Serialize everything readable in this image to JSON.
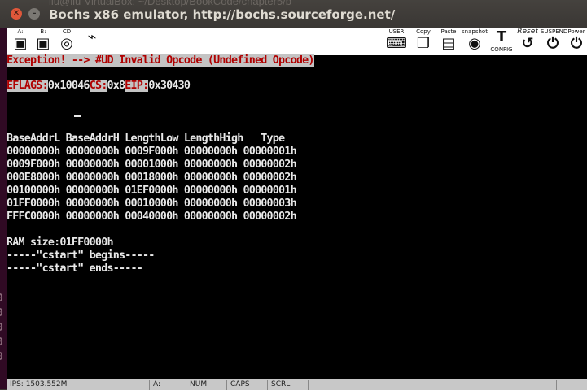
{
  "behind_window_title": "liu@liu-VirtualBox: ~/Desktop/BookCode/chapter5/b",
  "window": {
    "title": "Bochs x86 emulator, http://bochs.sourceforge.net/",
    "close_icon": "close-icon",
    "minimize_icon": "minimize-icon"
  },
  "toolbar": {
    "floppy_a_label": "A:",
    "floppy_b_label": "B:",
    "cd_label": "CD",
    "usb_label": "",
    "user_label": "USER",
    "copy_label": "Copy",
    "paste_label": "Paste",
    "snapshot_label": "snapshot",
    "config_label": "CONFIG",
    "reset_label": "Reset",
    "suspend_label": "SUSPEND",
    "power_label": "Power"
  },
  "screen": {
    "exception_line": "Exception! --> #UD Invalid Opcode (Undefined Opcode)",
    "eflags_label": "EFLAGS:",
    "eflags_value": "0x10046",
    "cs_label": "CS:",
    "cs_value": "0x8",
    "eip_label": "EIP:",
    "eip_value": "0x30430",
    "table_header": "BaseAddrL BaseAddrH LengthLow LengthHigh   Type",
    "table_rows": [
      "00000000h 00000000h 0009F000h 00000000h 00000001h",
      "0009F000h 00000000h 00001000h 00000000h 00000002h",
      "000E8000h 00000000h 00018000h 00000000h 00000002h",
      "00100000h 00000000h 01EF0000h 00000000h 00000001h",
      "01FF0000h 00000000h 00010000h 00000000h 00000003h",
      "FFFC0000h 00000000h 00040000h 00000000h 00000002h"
    ],
    "ram_line": "RAM size:01FF0000h",
    "cstart_begins": "-----\"cstart\" begins-----",
    "cstart_ends": "-----\"cstart\" ends-----"
  },
  "statusbar": {
    "ips": "IPS: 1503.552M",
    "drive": "A:",
    "num": "NUM",
    "caps": "CAPS",
    "scrl": "SCRL"
  }
}
